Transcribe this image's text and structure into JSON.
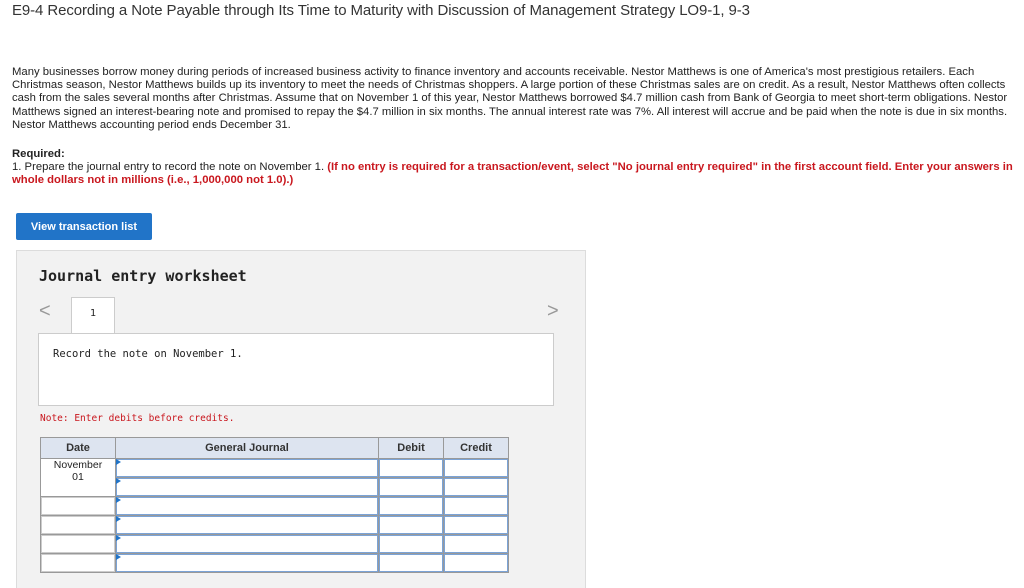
{
  "header": {
    "title": "E9-4 Recording a Note Payable through Its Time to Maturity with Discussion of Management Strategy LO9-1, 9-3"
  },
  "problem": {
    "paragraph": "Many businesses borrow money during periods of increased business activity to finance inventory and accounts receivable. Nestor Matthews is one of America's most prestigious retailers. Each Christmas season, Nestor Matthews builds up its inventory to meet the needs of Christmas shoppers. A large portion of these Christmas sales are on credit. As a result, Nestor Matthews often collects cash from the sales several months after Christmas. Assume that on November 1 of this year, Nestor Matthews borrowed $4.7 million cash from Bank of Georgia to meet short-term obligations. Nestor Matthews signed an interest-bearing note and promised to repay the $4.7 million in six months. The annual interest rate was 7%. All interest will accrue and be paid when the note is due in six months. Nestor Matthews accounting period ends December 31."
  },
  "required": {
    "heading": "Required:",
    "item_text": "1. Prepare the journal entry to record the note on November 1. ",
    "item_warning": "(If no entry is required for a transaction/event, select \"No journal entry required\" in the first account field. Enter your answers in whole dollars not in millions (i.e., 1,000,000 not 1.0).)"
  },
  "buttons": {
    "view_transaction_list": "View transaction list"
  },
  "worksheet": {
    "title": "Journal entry worksheet",
    "prev_icon": "chevron-left-icon",
    "next_icon": "chevron-right-icon",
    "prev_glyph": "<",
    "next_glyph": ">",
    "active_tab": "1",
    "description": "Record the note on November 1.",
    "note": "Note: Enter debits before credits."
  },
  "journal_table": {
    "headers": {
      "date": "Date",
      "account": "General Journal",
      "debit": "Debit",
      "credit": "Credit"
    },
    "date_line1": "November",
    "date_line2": "01",
    "rows": [
      {
        "account": "",
        "debit": "",
        "credit": ""
      },
      {
        "account": "",
        "debit": "",
        "credit": ""
      },
      {
        "account": "",
        "debit": "",
        "credit": ""
      },
      {
        "account": "",
        "debit": "",
        "credit": ""
      },
      {
        "account": "",
        "debit": "",
        "credit": ""
      },
      {
        "account": "",
        "debit": "",
        "credit": ""
      }
    ]
  },
  "colors": {
    "accent": "#2174c8",
    "warning": "#c9171e",
    "header_bg": "#dde4f0"
  }
}
